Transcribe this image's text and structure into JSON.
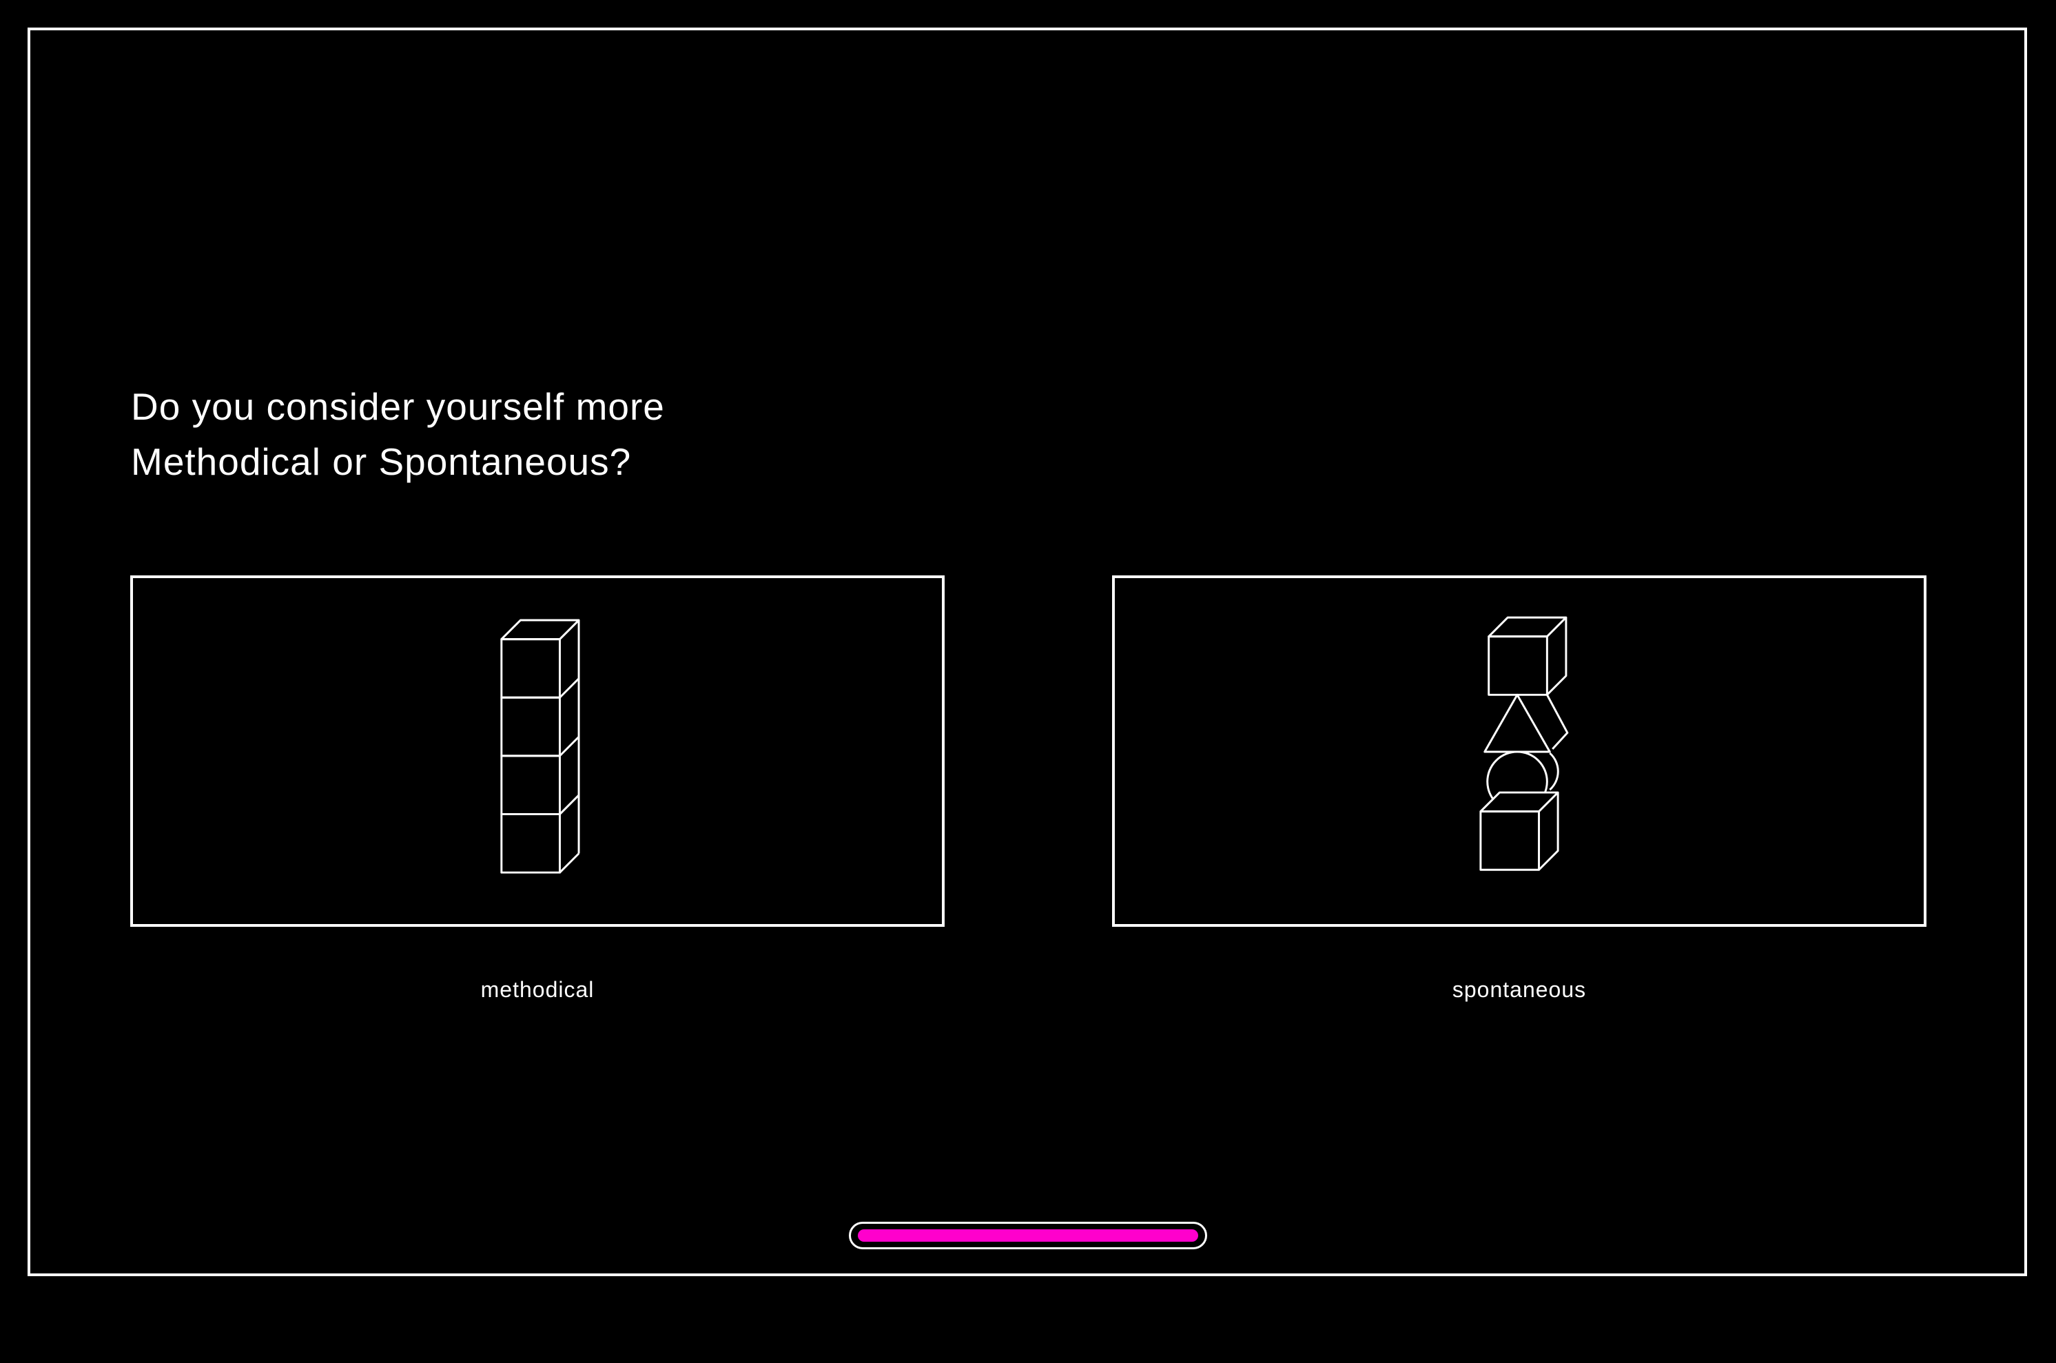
{
  "question": {
    "line1": "Do you consider yourself more",
    "line2": "Methodical or Spontaneous?"
  },
  "options": [
    {
      "label": "methodical",
      "icon": "stacked-cubes-icon"
    },
    {
      "label": "spontaneous",
      "icon": "stacked-mixed-shapes-icon"
    }
  ],
  "progress": {
    "value": 1.0,
    "color": "#ff00cc",
    "track_color": "#ffffff"
  },
  "colors": {
    "background": "#000000",
    "foreground": "#ffffff",
    "accent": "#ff00cc"
  }
}
